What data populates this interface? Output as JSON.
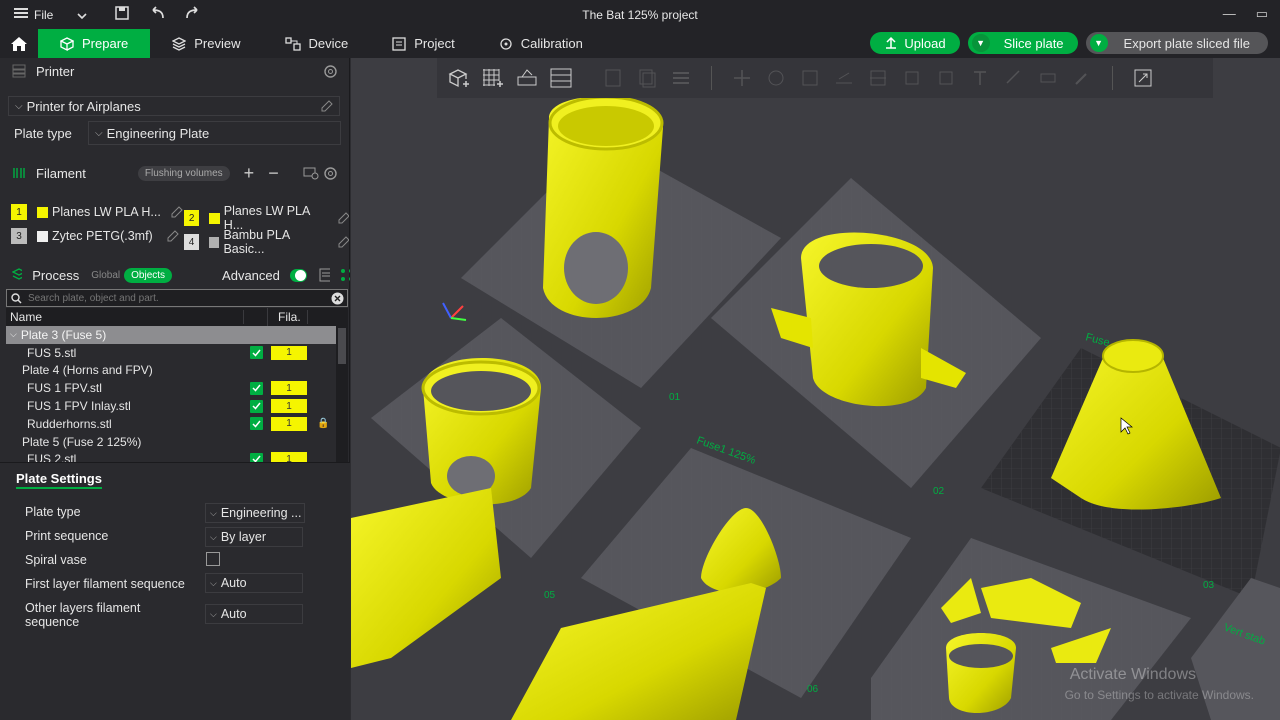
{
  "window": {
    "title": "The Bat 125% project",
    "file_menu": "File"
  },
  "tabs": [
    {
      "label": "Prepare"
    },
    {
      "label": "Preview"
    },
    {
      "label": "Device"
    },
    {
      "label": "Project"
    },
    {
      "label": "Calibration"
    }
  ],
  "actions": {
    "upload": "Upload",
    "slice": "Slice plate",
    "export": "Export plate sliced file"
  },
  "printer": {
    "section": "Printer",
    "name": "Printer for Airplanes",
    "plate_type_label": "Plate type",
    "plate_type_value": "Engineering Plate"
  },
  "filament": {
    "section": "Filament",
    "flushing": "Flushing volumes",
    "items": [
      {
        "num": "1",
        "name": "Planes LW PLA H...",
        "color": "#f5f500"
      },
      {
        "num": "2",
        "name": "Planes LW PLA H...",
        "color": "#f5f500"
      },
      {
        "num": "3",
        "name": "Zytec PETG(.3mf)",
        "color": "#f0f0f0"
      },
      {
        "num": "4",
        "name": "Bambu PLA Basic...",
        "color": "#b0b0b0"
      }
    ]
  },
  "process": {
    "section": "Process",
    "global": "Global",
    "objects": "Objects",
    "advanced": "Advanced"
  },
  "search": {
    "placeholder": "Search plate, object and part."
  },
  "objects": {
    "col_name": "Name",
    "col_fila": "Fila.",
    "rows": [
      {
        "label": "Plate 3 (Fuse 5)",
        "type": "plate",
        "selected": true
      },
      {
        "label": "FUS 5.stl",
        "type": "obj",
        "fila": "1"
      },
      {
        "label": "Plate 4 (Horns and FPV)",
        "type": "plate"
      },
      {
        "label": "FUS 1 FPV.stl",
        "type": "obj",
        "fila": "1"
      },
      {
        "label": "FUS 1 FPV Inlay.stl",
        "type": "obj",
        "fila": "1"
      },
      {
        "label": "Rudderhorns.stl",
        "type": "obj",
        "fila": "1"
      },
      {
        "label": "Plate 5 (Fuse 2 125%)",
        "type": "plate"
      },
      {
        "label": "FUS 2.stl",
        "type": "obj",
        "fila": "1"
      }
    ]
  },
  "plate_settings": {
    "title": "Plate Settings",
    "plate_type": {
      "label": "Plate type",
      "value": "Engineering ..."
    },
    "print_sequence": {
      "label": "Print sequence",
      "value": "By layer"
    },
    "spiral_vase": {
      "label": "Spiral vase"
    },
    "first_layer": {
      "label": "First layer filament sequence",
      "value": "Auto"
    },
    "other_layers": {
      "label": "Other layers filament sequence",
      "value": "Auto"
    }
  },
  "viewport": {
    "plate_labels": [
      "Fuse1 125%",
      "Fuse",
      "Vert stab"
    ],
    "plate_numbers": [
      "01",
      "02",
      "03",
      "05",
      "06"
    ],
    "watermark_title": "Activate Windows",
    "watermark_sub": "Go to Settings to activate Windows."
  },
  "colors": {
    "accent": "#00ae42",
    "filament": "#f5f500"
  }
}
